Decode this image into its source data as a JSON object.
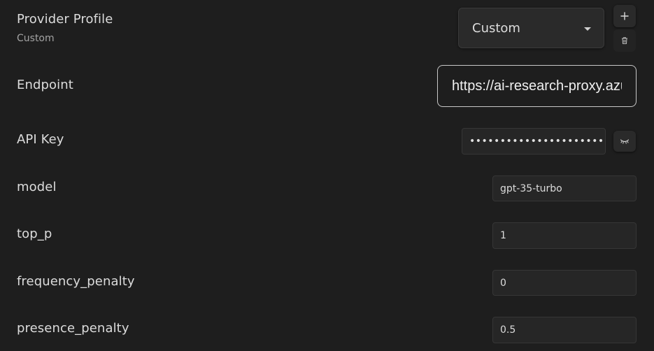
{
  "provider_profile": {
    "label": "Provider Profile",
    "sublabel": "Custom",
    "selected": "Custom",
    "add_icon": "plus-icon",
    "delete_icon": "trash-icon"
  },
  "endpoint": {
    "label": "Endpoint",
    "value": "https://ai-research-proxy.azu"
  },
  "api_key": {
    "label": "API Key",
    "value": "••••••••••••••••••••••••",
    "toggle_icon": "eye-closed-icon"
  },
  "model": {
    "label": "model",
    "value": "gpt-35-turbo"
  },
  "top_p": {
    "label": "top_p",
    "value": "1"
  },
  "frequency_penalty": {
    "label": "frequency_penalty",
    "value": "0"
  },
  "presence_penalty": {
    "label": "presence_penalty",
    "value": "0.5"
  }
}
